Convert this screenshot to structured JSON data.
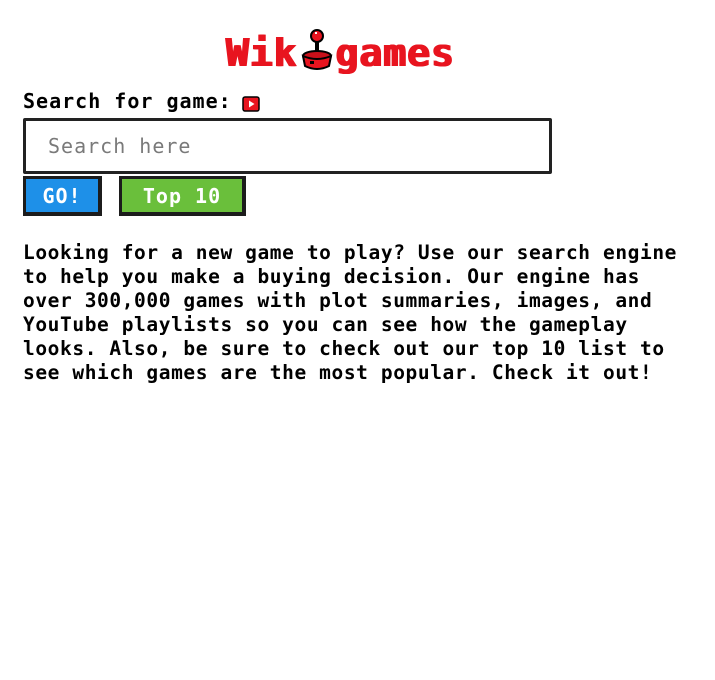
{
  "logo": {
    "text_left": "Wik",
    "text_right": "games",
    "icon": "joystick-icon",
    "color": "#e8141f"
  },
  "search": {
    "label": "Search for game:",
    "label_icon": "youtube-play-icon",
    "placeholder": "Search here",
    "value": ""
  },
  "buttons": {
    "go_label": "GO!",
    "top10_label": "Top 10",
    "go_color": "#1e90e8",
    "top10_color": "#6abf3b"
  },
  "intro": {
    "text": "Looking for a new game to play? Use our search engine to help you make a buying decision. Our engine has over 300,000 games with plot summaries, images, and YouTube playlists so you can see how the gameplay looks. Also, be sure to check out our top 10 list to see which games are the most popular. Check it out!"
  }
}
